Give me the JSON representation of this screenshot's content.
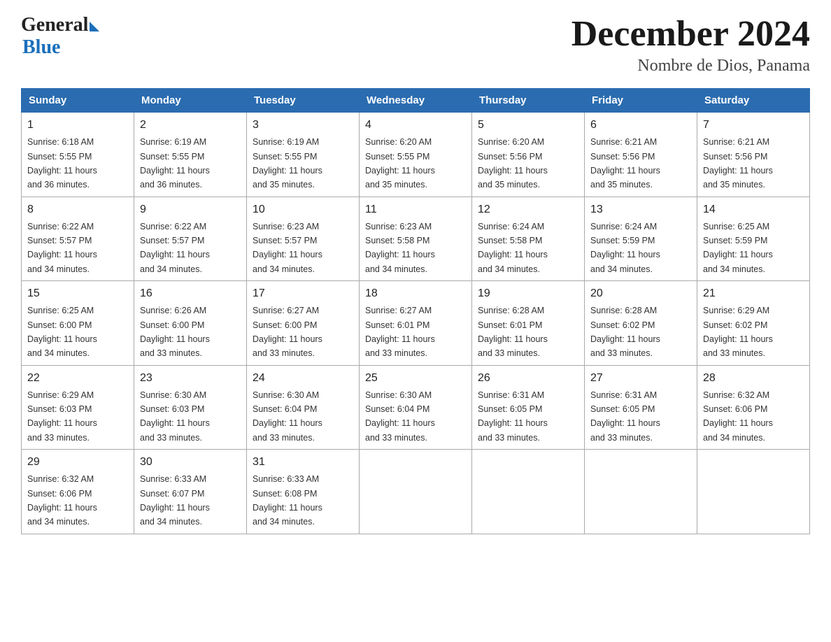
{
  "header": {
    "logo_general": "General",
    "logo_blue": "Blue",
    "title": "December 2024",
    "subtitle": "Nombre de Dios, Panama"
  },
  "days_of_week": [
    "Sunday",
    "Monday",
    "Tuesday",
    "Wednesday",
    "Thursday",
    "Friday",
    "Saturday"
  ],
  "weeks": [
    [
      {
        "day": "1",
        "info": "Sunrise: 6:18 AM\nSunset: 5:55 PM\nDaylight: 11 hours\nand 36 minutes."
      },
      {
        "day": "2",
        "info": "Sunrise: 6:19 AM\nSunset: 5:55 PM\nDaylight: 11 hours\nand 36 minutes."
      },
      {
        "day": "3",
        "info": "Sunrise: 6:19 AM\nSunset: 5:55 PM\nDaylight: 11 hours\nand 35 minutes."
      },
      {
        "day": "4",
        "info": "Sunrise: 6:20 AM\nSunset: 5:55 PM\nDaylight: 11 hours\nand 35 minutes."
      },
      {
        "day": "5",
        "info": "Sunrise: 6:20 AM\nSunset: 5:56 PM\nDaylight: 11 hours\nand 35 minutes."
      },
      {
        "day": "6",
        "info": "Sunrise: 6:21 AM\nSunset: 5:56 PM\nDaylight: 11 hours\nand 35 minutes."
      },
      {
        "day": "7",
        "info": "Sunrise: 6:21 AM\nSunset: 5:56 PM\nDaylight: 11 hours\nand 35 minutes."
      }
    ],
    [
      {
        "day": "8",
        "info": "Sunrise: 6:22 AM\nSunset: 5:57 PM\nDaylight: 11 hours\nand 34 minutes."
      },
      {
        "day": "9",
        "info": "Sunrise: 6:22 AM\nSunset: 5:57 PM\nDaylight: 11 hours\nand 34 minutes."
      },
      {
        "day": "10",
        "info": "Sunrise: 6:23 AM\nSunset: 5:57 PM\nDaylight: 11 hours\nand 34 minutes."
      },
      {
        "day": "11",
        "info": "Sunrise: 6:23 AM\nSunset: 5:58 PM\nDaylight: 11 hours\nand 34 minutes."
      },
      {
        "day": "12",
        "info": "Sunrise: 6:24 AM\nSunset: 5:58 PM\nDaylight: 11 hours\nand 34 minutes."
      },
      {
        "day": "13",
        "info": "Sunrise: 6:24 AM\nSunset: 5:59 PM\nDaylight: 11 hours\nand 34 minutes."
      },
      {
        "day": "14",
        "info": "Sunrise: 6:25 AM\nSunset: 5:59 PM\nDaylight: 11 hours\nand 34 minutes."
      }
    ],
    [
      {
        "day": "15",
        "info": "Sunrise: 6:25 AM\nSunset: 6:00 PM\nDaylight: 11 hours\nand 34 minutes."
      },
      {
        "day": "16",
        "info": "Sunrise: 6:26 AM\nSunset: 6:00 PM\nDaylight: 11 hours\nand 33 minutes."
      },
      {
        "day": "17",
        "info": "Sunrise: 6:27 AM\nSunset: 6:00 PM\nDaylight: 11 hours\nand 33 minutes."
      },
      {
        "day": "18",
        "info": "Sunrise: 6:27 AM\nSunset: 6:01 PM\nDaylight: 11 hours\nand 33 minutes."
      },
      {
        "day": "19",
        "info": "Sunrise: 6:28 AM\nSunset: 6:01 PM\nDaylight: 11 hours\nand 33 minutes."
      },
      {
        "day": "20",
        "info": "Sunrise: 6:28 AM\nSunset: 6:02 PM\nDaylight: 11 hours\nand 33 minutes."
      },
      {
        "day": "21",
        "info": "Sunrise: 6:29 AM\nSunset: 6:02 PM\nDaylight: 11 hours\nand 33 minutes."
      }
    ],
    [
      {
        "day": "22",
        "info": "Sunrise: 6:29 AM\nSunset: 6:03 PM\nDaylight: 11 hours\nand 33 minutes."
      },
      {
        "day": "23",
        "info": "Sunrise: 6:30 AM\nSunset: 6:03 PM\nDaylight: 11 hours\nand 33 minutes."
      },
      {
        "day": "24",
        "info": "Sunrise: 6:30 AM\nSunset: 6:04 PM\nDaylight: 11 hours\nand 33 minutes."
      },
      {
        "day": "25",
        "info": "Sunrise: 6:30 AM\nSunset: 6:04 PM\nDaylight: 11 hours\nand 33 minutes."
      },
      {
        "day": "26",
        "info": "Sunrise: 6:31 AM\nSunset: 6:05 PM\nDaylight: 11 hours\nand 33 minutes."
      },
      {
        "day": "27",
        "info": "Sunrise: 6:31 AM\nSunset: 6:05 PM\nDaylight: 11 hours\nand 33 minutes."
      },
      {
        "day": "28",
        "info": "Sunrise: 6:32 AM\nSunset: 6:06 PM\nDaylight: 11 hours\nand 34 minutes."
      }
    ],
    [
      {
        "day": "29",
        "info": "Sunrise: 6:32 AM\nSunset: 6:06 PM\nDaylight: 11 hours\nand 34 minutes."
      },
      {
        "day": "30",
        "info": "Sunrise: 6:33 AM\nSunset: 6:07 PM\nDaylight: 11 hours\nand 34 minutes."
      },
      {
        "day": "31",
        "info": "Sunrise: 6:33 AM\nSunset: 6:08 PM\nDaylight: 11 hours\nand 34 minutes."
      },
      {
        "day": "",
        "info": ""
      },
      {
        "day": "",
        "info": ""
      },
      {
        "day": "",
        "info": ""
      },
      {
        "day": "",
        "info": ""
      }
    ]
  ]
}
